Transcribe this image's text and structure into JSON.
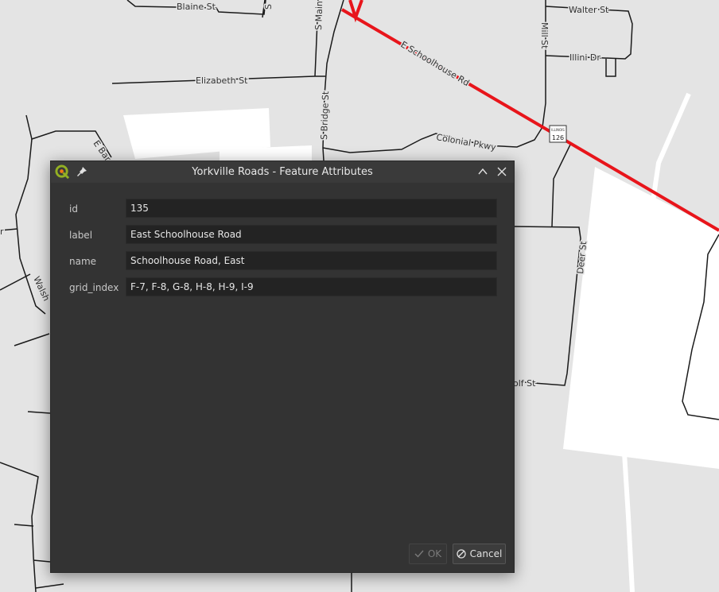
{
  "map": {
    "street_labels": {
      "blaine": "Blaine St",
      "s_main": "S Main",
      "walter": "Walter St",
      "mill": "Mill St",
      "illini": "Illini Dr",
      "schoolhouse": "E Schoolhouse Rd",
      "elizabeth": "Elizabeth St",
      "s_bridge": "S Bridge St",
      "colonial": "Colonial Pkwy",
      "e_bar": "E Bar",
      "walsh": "Walsh",
      "deer": "Deer St",
      "wolf": "olf St",
      "s_cut": "S",
      "r_cut": "r"
    },
    "route_shield": "126",
    "route_shield_top": "ILLINOIS",
    "highlight_color": "#e8151b"
  },
  "dialog": {
    "title": "Yorkville Roads - Feature Attributes",
    "fields": [
      {
        "label": "id",
        "value": "135"
      },
      {
        "label": "label",
        "value": "East Schoolhouse Road"
      },
      {
        "label": "name",
        "value": "Schoolhouse Road, East"
      },
      {
        "label": "grid_index",
        "value": "F-7, F-8, G-8, H-8, H-9, I-9"
      }
    ],
    "ok_label": "OK",
    "cancel_label": "Cancel"
  }
}
